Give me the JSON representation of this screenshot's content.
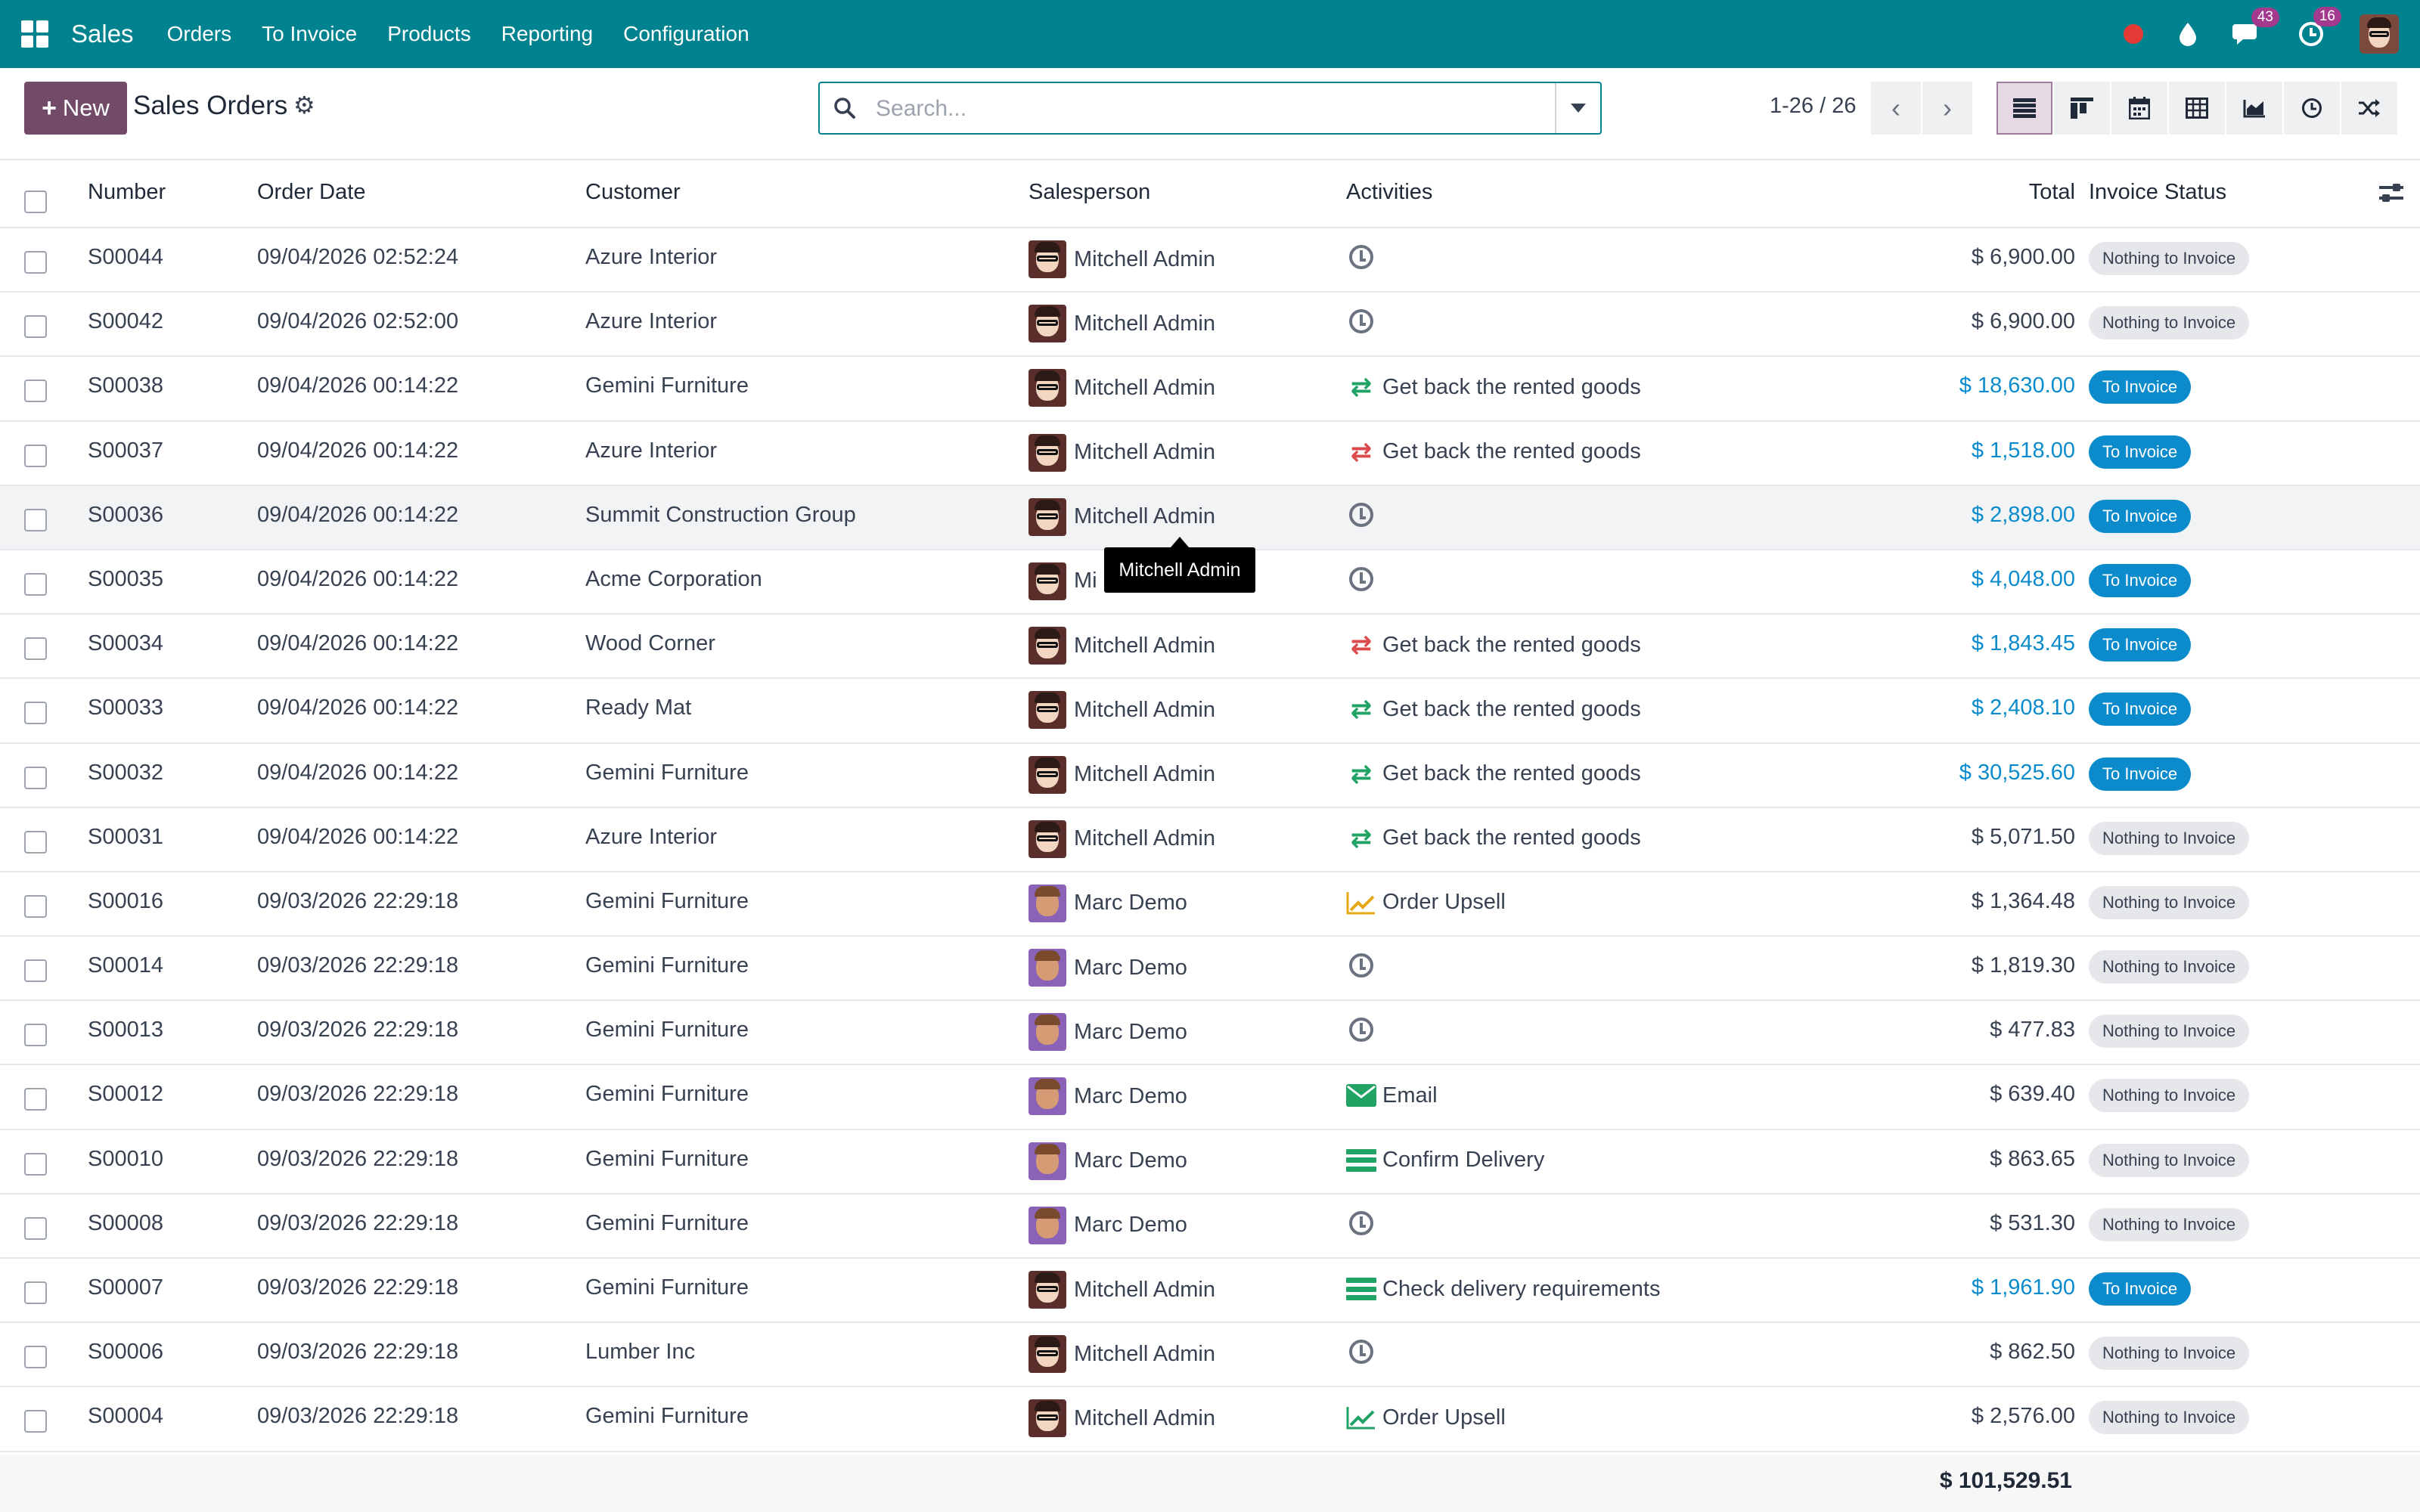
{
  "nav": {
    "app_name": "Sales",
    "items": [
      "Orders",
      "To Invoice",
      "Products",
      "Reporting",
      "Configuration"
    ],
    "messages_badge": "43",
    "activities_badge": "16",
    "icons": [
      "status-dot-icon",
      "droplet-icon",
      "chat-icon",
      "clock-icon",
      "user-avatar"
    ]
  },
  "control": {
    "new_label": "New",
    "title": "Sales Orders",
    "search_placeholder": "Search...",
    "pager": "1-26 / 26",
    "views": [
      "list-view-icon",
      "kanban-view-icon",
      "calendar-view-icon",
      "pivot-view-icon",
      "graph-view-icon",
      "activity-view-icon",
      "map-view-icon"
    ]
  },
  "columns": {
    "number": "Number",
    "order_date": "Order Date",
    "customer": "Customer",
    "salesperson": "Salesperson",
    "activities": "Activities",
    "total": "Total",
    "invoice_status": "Invoice Status"
  },
  "rows": [
    {
      "number": "S00044",
      "date": "09/04/2026 02:52:24",
      "customer": "Azure Interior",
      "salesperson": "Mitchell Admin",
      "avatar": "mitchell",
      "activity": "",
      "act_icon": "clock",
      "total": "$ 6,900.00",
      "total_color": "default",
      "status": "Nothing to Invoice",
      "status_color": "grey"
    },
    {
      "number": "S00042",
      "date": "09/04/2026 02:52:00",
      "customer": "Azure Interior",
      "salesperson": "Mitchell Admin",
      "avatar": "mitchell",
      "activity": "",
      "act_icon": "clock",
      "total": "$ 6,900.00",
      "total_color": "default",
      "status": "Nothing to Invoice",
      "status_color": "grey"
    },
    {
      "number": "S00038",
      "date": "09/04/2026 00:14:22",
      "customer": "Gemini Furniture",
      "salesperson": "Mitchell Admin",
      "avatar": "mitchell",
      "activity": "Get back the rented goods",
      "act_icon": "swap-green",
      "total": "$ 18,630.00",
      "total_color": "blue",
      "status": "To Invoice",
      "status_color": "blue"
    },
    {
      "number": "S00037",
      "date": "09/04/2026 00:14:22",
      "customer": "Azure Interior",
      "salesperson": "Mitchell Admin",
      "avatar": "mitchell",
      "activity": "Get back the rented goods",
      "act_icon": "swap-red",
      "total": "$ 1,518.00",
      "total_color": "blue",
      "status": "To Invoice",
      "status_color": "blue"
    },
    {
      "number": "S00036",
      "date": "09/04/2026 00:14:22",
      "customer": "Summit Construction Group",
      "salesperson": "Mitchell Admin",
      "avatar": "mitchell",
      "activity": "",
      "act_icon": "clock",
      "total": "$ 2,898.00",
      "total_color": "blue",
      "status": "To Invoice",
      "status_color": "blue"
    },
    {
      "number": "S00035",
      "date": "09/04/2026 00:14:22",
      "customer": "Acme Corporation",
      "salesperson": "Mi",
      "avatar": "mitchell",
      "activity": "",
      "act_icon": "clock",
      "total": "$ 4,048.00",
      "total_color": "blue",
      "status": "To Invoice",
      "status_color": "blue"
    },
    {
      "number": "S00034",
      "date": "09/04/2026 00:14:22",
      "customer": "Wood Corner",
      "salesperson": "Mitchell Admin",
      "avatar": "mitchell",
      "activity": "Get back the rented goods",
      "act_icon": "swap-red",
      "total": "$ 1,843.45",
      "total_color": "blue",
      "status": "To Invoice",
      "status_color": "blue"
    },
    {
      "number": "S00033",
      "date": "09/04/2026 00:14:22",
      "customer": "Ready Mat",
      "salesperson": "Mitchell Admin",
      "avatar": "mitchell",
      "activity": "Get back the rented goods",
      "act_icon": "swap-green",
      "total": "$ 2,408.10",
      "total_color": "blue",
      "status": "To Invoice",
      "status_color": "blue"
    },
    {
      "number": "S00032",
      "date": "09/04/2026 00:14:22",
      "customer": "Gemini Furniture",
      "salesperson": "Mitchell Admin",
      "avatar": "mitchell",
      "activity": "Get back the rented goods",
      "act_icon": "swap-green",
      "total": "$ 30,525.60",
      "total_color": "blue",
      "status": "To Invoice",
      "status_color": "blue"
    },
    {
      "number": "S00031",
      "date": "09/04/2026 00:14:22",
      "customer": "Azure Interior",
      "salesperson": "Mitchell Admin",
      "avatar": "mitchell",
      "activity": "Get back the rented goods",
      "act_icon": "swap-green",
      "total": "$ 5,071.50",
      "total_color": "default",
      "status": "Nothing to Invoice",
      "status_color": "grey"
    },
    {
      "number": "S00016",
      "date": "09/03/2026 22:29:18",
      "customer": "Gemini Furniture",
      "salesperson": "Marc Demo",
      "avatar": "marc",
      "activity": "Order Upsell",
      "act_icon": "upsell-gold",
      "total": "$ 1,364.48",
      "total_color": "default",
      "status": "Nothing to Invoice",
      "status_color": "grey"
    },
    {
      "number": "S00014",
      "date": "09/03/2026 22:29:18",
      "customer": "Gemini Furniture",
      "salesperson": "Marc Demo",
      "avatar": "marc",
      "activity": "",
      "act_icon": "clock",
      "total": "$ 1,819.30",
      "total_color": "default",
      "status": "Nothing to Invoice",
      "status_color": "grey"
    },
    {
      "number": "S00013",
      "date": "09/03/2026 22:29:18",
      "customer": "Gemini Furniture",
      "salesperson": "Marc Demo",
      "avatar": "marc",
      "activity": "",
      "act_icon": "clock",
      "total": "$ 477.83",
      "total_color": "default",
      "status": "Nothing to Invoice",
      "status_color": "grey"
    },
    {
      "number": "S00012",
      "date": "09/03/2026 22:29:18",
      "customer": "Gemini Furniture",
      "salesperson": "Marc Demo",
      "avatar": "marc",
      "activity": "Email",
      "act_icon": "mail-green",
      "total": "$ 639.40",
      "total_color": "default",
      "status": "Nothing to Invoice",
      "status_color": "grey"
    },
    {
      "number": "S00010",
      "date": "09/03/2026 22:29:18",
      "customer": "Gemini Furniture",
      "salesperson": "Marc Demo",
      "avatar": "marc",
      "activity": "Confirm Delivery",
      "act_icon": "tasks-green",
      "total": "$ 863.65",
      "total_color": "default",
      "status": "Nothing to Invoice",
      "status_color": "grey"
    },
    {
      "number": "S00008",
      "date": "09/03/2026 22:29:18",
      "customer": "Gemini Furniture",
      "salesperson": "Marc Demo",
      "avatar": "marc",
      "activity": "",
      "act_icon": "clock",
      "total": "$ 531.30",
      "total_color": "default",
      "status": "Nothing to Invoice",
      "status_color": "grey"
    },
    {
      "number": "S00007",
      "date": "09/03/2026 22:29:18",
      "customer": "Gemini Furniture",
      "salesperson": "Mitchell Admin",
      "avatar": "mitchell",
      "activity": "Check delivery requirements",
      "act_icon": "tasks-green",
      "total": "$ 1,961.90",
      "total_color": "blue",
      "status": "To Invoice",
      "status_color": "blue"
    },
    {
      "number": "S00006",
      "date": "09/03/2026 22:29:18",
      "customer": "Lumber Inc",
      "salesperson": "Mitchell Admin",
      "avatar": "mitchell",
      "activity": "",
      "act_icon": "clock",
      "total": "$ 862.50",
      "total_color": "default",
      "status": "Nothing to Invoice",
      "status_color": "grey"
    },
    {
      "number": "S00004",
      "date": "09/03/2026 22:29:18",
      "customer": "Gemini Furniture",
      "salesperson": "Mitchell Admin",
      "avatar": "mitchell",
      "activity": "Order Upsell",
      "act_icon": "upsell-green",
      "total": "$ 2,576.00",
      "total_color": "default",
      "status": "Nothing to Invoice",
      "status_color": "grey"
    }
  ],
  "footer": {
    "grand_total": "$ 101,529.51"
  },
  "tooltip": {
    "text": "Mitchell Admin"
  },
  "colors": {
    "brand": "#00838f",
    "primary_button": "#714b67",
    "link_blue": "#0b8bcc",
    "activity_green": "#21a366",
    "activity_red": "#dc4b4b"
  }
}
